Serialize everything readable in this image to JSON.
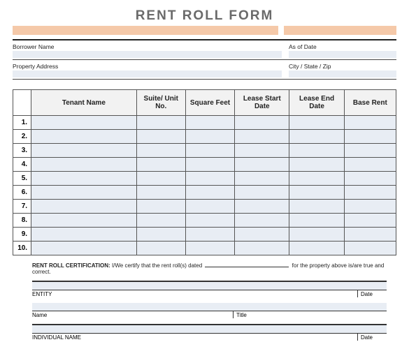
{
  "title": "RENT ROLL FORM",
  "info": {
    "borrower_label": "Borrower Name",
    "asof_label": "As of Date",
    "property_label": "Property Address",
    "citystate_label": "City / State / Zip"
  },
  "headers": {
    "num": "",
    "tenant": "Tenant Name",
    "suite": "Suite/ Unit No.",
    "sqft": "Square Feet",
    "start": "Lease Start Date",
    "end": "Lease End Date",
    "rent": "Base Rent"
  },
  "rows": [
    "1.",
    "2.",
    "3.",
    "4.",
    "5.",
    "6.",
    "7.",
    "8.",
    "9.",
    "10."
  ],
  "cert": {
    "label": "RENT ROLL CERTIFICATION:",
    "text1": "I/We certify that the rent roll(s) dated",
    "text2": "for the property above is/are true and correct.",
    "entity": "ENTITY",
    "date": "Date",
    "name": "Name",
    "title": "Title",
    "individual": "INDIVIDUAL NAME"
  }
}
